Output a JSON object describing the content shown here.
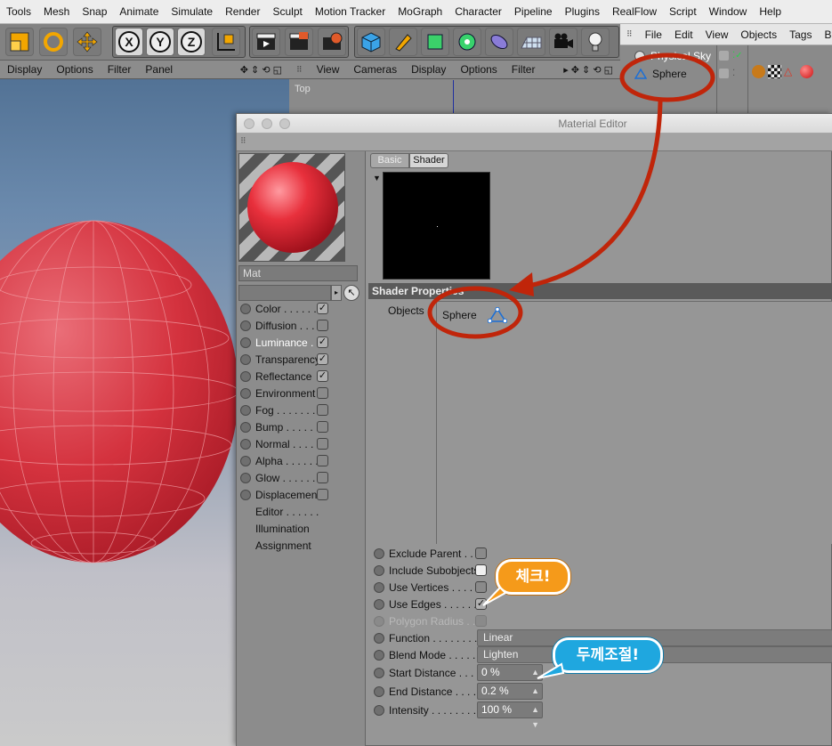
{
  "menubar": {
    "items": [
      "Tools",
      "Mesh",
      "Snap",
      "Animate",
      "Simulate",
      "Render",
      "Sculpt",
      "Motion Tracker",
      "MoGraph",
      "Character",
      "Pipeline",
      "Plugins",
      "RealFlow",
      "Script",
      "Window",
      "Help"
    ]
  },
  "toolbar": {
    "icons": [
      "scale-icon",
      "rotate-icon",
      "move-icon",
      "x-axis-icon",
      "y-axis-icon",
      "z-axis-icon",
      "coordinate-icon",
      "render-view-icon",
      "render-picture-icon",
      "render-settings-icon",
      "cube-icon",
      "pen-icon",
      "subdivision-icon",
      "cloner-icon",
      "deformer-icon",
      "floor-icon",
      "camera-icon",
      "light-icon"
    ],
    "x_label": "X",
    "y_label": "Y",
    "z_label": "Z"
  },
  "viewport1": {
    "menu": [
      "Display",
      "Options",
      "Filter",
      "Panel"
    ]
  },
  "viewport2": {
    "menu": [
      "View",
      "Cameras",
      "Display",
      "Options",
      "Filter"
    ],
    "label": "Top"
  },
  "object_manager": {
    "menu": [
      "File",
      "Edit",
      "View",
      "Objects",
      "Tags",
      "Boo"
    ],
    "objects": [
      "Physical Sky",
      "Sphere"
    ]
  },
  "material_editor": {
    "title": "Material Editor",
    "material_name": "Mat",
    "channels": [
      {
        "label": "Color . . . . . .",
        "checked": true,
        "hasbox": true
      },
      {
        "label": "Diffusion . . . .",
        "checked": false,
        "hasbox": true
      },
      {
        "label": "Luminance . .",
        "checked": true,
        "hasbox": true,
        "active": true
      },
      {
        "label": "Transparency",
        "checked": true,
        "hasbox": true
      },
      {
        "label": "Reflectance",
        "checked": true,
        "hasbox": true
      },
      {
        "label": "Environment",
        "checked": false,
        "hasbox": true
      },
      {
        "label": "Fog . . . . . . . .",
        "checked": false,
        "hasbox": true
      },
      {
        "label": "Bump . . . . . .",
        "checked": false,
        "hasbox": true
      },
      {
        "label": "Normal . . . . .",
        "checked": false,
        "hasbox": true
      },
      {
        "label": "Alpha . . . . . .",
        "checked": false,
        "hasbox": true
      },
      {
        "label": "Glow . . . . . . .",
        "checked": false,
        "hasbox": true
      },
      {
        "label": "Displacement",
        "checked": false,
        "hasbox": true
      },
      {
        "label": "Editor . . . . . .",
        "checked": false,
        "hasbox": false
      },
      {
        "label": "Illumination",
        "checked": false,
        "hasbox": false
      },
      {
        "label": "Assignment",
        "checked": false,
        "hasbox": false
      }
    ],
    "tabs": [
      "Basic",
      "Shader"
    ],
    "section_title": "Shader Properties",
    "objects_label": "Objects",
    "object_item": "Sphere",
    "props": {
      "exclude_parent": "Exclude Parent . .",
      "include_subobjects": "Include Subobjects",
      "use_vertices": "Use Vertices . . . . .",
      "use_edges": "Use Edges . . . . . .",
      "polygon_radius": "Polygon Radius . .",
      "function_label": "Function . . . . . . . .",
      "function_value": "Linear",
      "blend_label": "Blend Mode . . . . .",
      "blend_value": "Lighten",
      "start_label": "Start Distance . . .",
      "start_value": "0 %",
      "end_label": "End Distance . . . .",
      "end_value": "0.2 %",
      "intensity_label": "Intensity . . . . . . . .",
      "intensity_value": "100 %"
    }
  },
  "annotations": {
    "check": "체크!",
    "thickness": "두께조절!"
  },
  "colors": {
    "annotation_red": "#c0250a",
    "bubble_orange": "#f59a1a",
    "bubble_blue": "#1fa7df",
    "sphere_red": "#d42a36"
  }
}
